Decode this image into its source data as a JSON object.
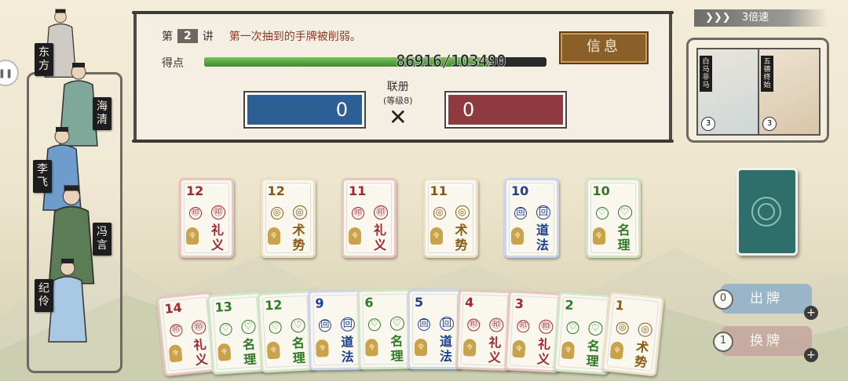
{
  "header": {
    "lesson_prefix": "第",
    "lesson_number": "2",
    "lesson_suffix": "讲",
    "tip": "第一次抽到的手牌被削弱。",
    "info_button": "信息",
    "score_label": "得点",
    "score_text": "86916/103490",
    "score_progress": 0.84,
    "combo_name": "联册",
    "combo_level": "(等级8)",
    "blue_score": "0",
    "red_score": "0"
  },
  "speed": {
    "label": "3倍速"
  },
  "characters": [
    {
      "name": "东方",
      "color": "#cfcac4"
    },
    {
      "name": "海清",
      "color": "#7fa79a"
    },
    {
      "name": "李飞",
      "color": "#6e9ccc"
    },
    {
      "name": "冯言",
      "color": "#5b7d55"
    },
    {
      "name": "纪伶",
      "color": "#a8c8e4"
    }
  ],
  "special_cards": [
    {
      "name": "白马非马",
      "count": "3"
    },
    {
      "name": "五德终始",
      "count": "3"
    }
  ],
  "table_cards": [
    {
      "num": "12",
      "school": "礼义",
      "color": "red"
    },
    {
      "num": "12",
      "school": "术势",
      "color": "gold"
    },
    {
      "num": "11",
      "school": "礼义",
      "color": "red"
    },
    {
      "num": "11",
      "school": "术势",
      "color": "gold"
    },
    {
      "num": "10",
      "school": "道法",
      "color": "blue"
    },
    {
      "num": "10",
      "school": "名理",
      "color": "green"
    }
  ],
  "hand_cards": [
    {
      "num": "14",
      "school": "礼义",
      "color": "red"
    },
    {
      "num": "13",
      "school": "名理",
      "color": "green"
    },
    {
      "num": "12",
      "school": "名理",
      "color": "green"
    },
    {
      "num": "9",
      "school": "道法",
      "color": "blue"
    },
    {
      "num": "6",
      "school": "名理",
      "color": "green"
    },
    {
      "num": "5",
      "school": "道法",
      "color": "blue"
    },
    {
      "num": "4",
      "school": "礼义",
      "color": "red"
    },
    {
      "num": "3",
      "school": "礼义",
      "color": "red"
    },
    {
      "num": "2",
      "school": "名理",
      "color": "green"
    },
    {
      "num": "1",
      "school": "术势",
      "color": "gold"
    }
  ],
  "actions": {
    "play_label": "出牌",
    "play_count": "0",
    "swap_label": "换牌",
    "swap_count": "1"
  }
}
